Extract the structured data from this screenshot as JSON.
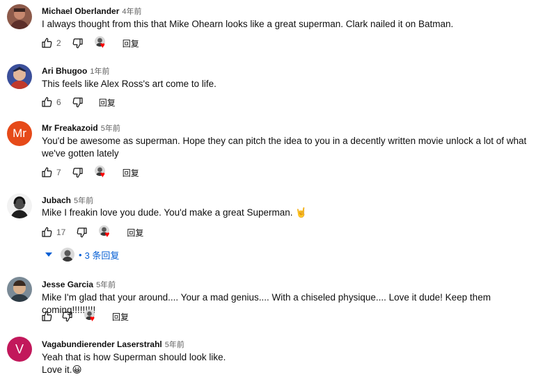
{
  "comments": [
    {
      "author": "Michael Oberlander",
      "time": "4年前",
      "text": "I always thought from this that Mike Ohearn looks like a great superman. Clark nailed it on Batman.",
      "likes": "2",
      "reply_label": "回复",
      "creator_heart": true
    },
    {
      "author": "Ari Bhugoo",
      "time": "1年前",
      "text": "This feels like Alex Ross's art come to life.",
      "likes": "6",
      "reply_label": "回复",
      "creator_heart": false
    },
    {
      "author": "Mr Freakazoid",
      "time": "5年前",
      "avatar_initials": "Mr",
      "avatar_color": "#e64a19",
      "text": "You'd be awesome as superman. Hope they can pitch the idea to you in a decently written movie unlock a lot of what we've gotten lately",
      "likes": "7",
      "reply_label": "回复",
      "creator_heart": true
    },
    {
      "author": "Jubach",
      "time": "5年前",
      "text": "Mike I freakin love you dude. You'd make a great Superman. 🤘",
      "likes": "17",
      "reply_label": "回复",
      "creator_heart": true,
      "replies_label": "3 条回复"
    },
    {
      "author": "Jesse Garcia",
      "time": "5年前",
      "text": "Mike I'm glad that your around.... Your a mad genius.... With a chiseled physique.... Love it dude! Keep them coming!!!!!!!!!",
      "likes": "",
      "reply_label": "回复",
      "creator_heart": true
    },
    {
      "author": "Vagabundierender Laserstrahl",
      "time": "5年前",
      "avatar_initials": "V",
      "avatar_color": "#c2185b",
      "text_line1": "Yeah that is how Superman should look like.",
      "text_line2": "Love it.😀"
    }
  ],
  "colors": {
    "heart": "#ff0000",
    "link": "#065fd4",
    "secondary": "#606060"
  },
  "icons": [
    "thumb-up-icon",
    "thumb-down-icon",
    "heart-icon",
    "caret-down-icon"
  ]
}
